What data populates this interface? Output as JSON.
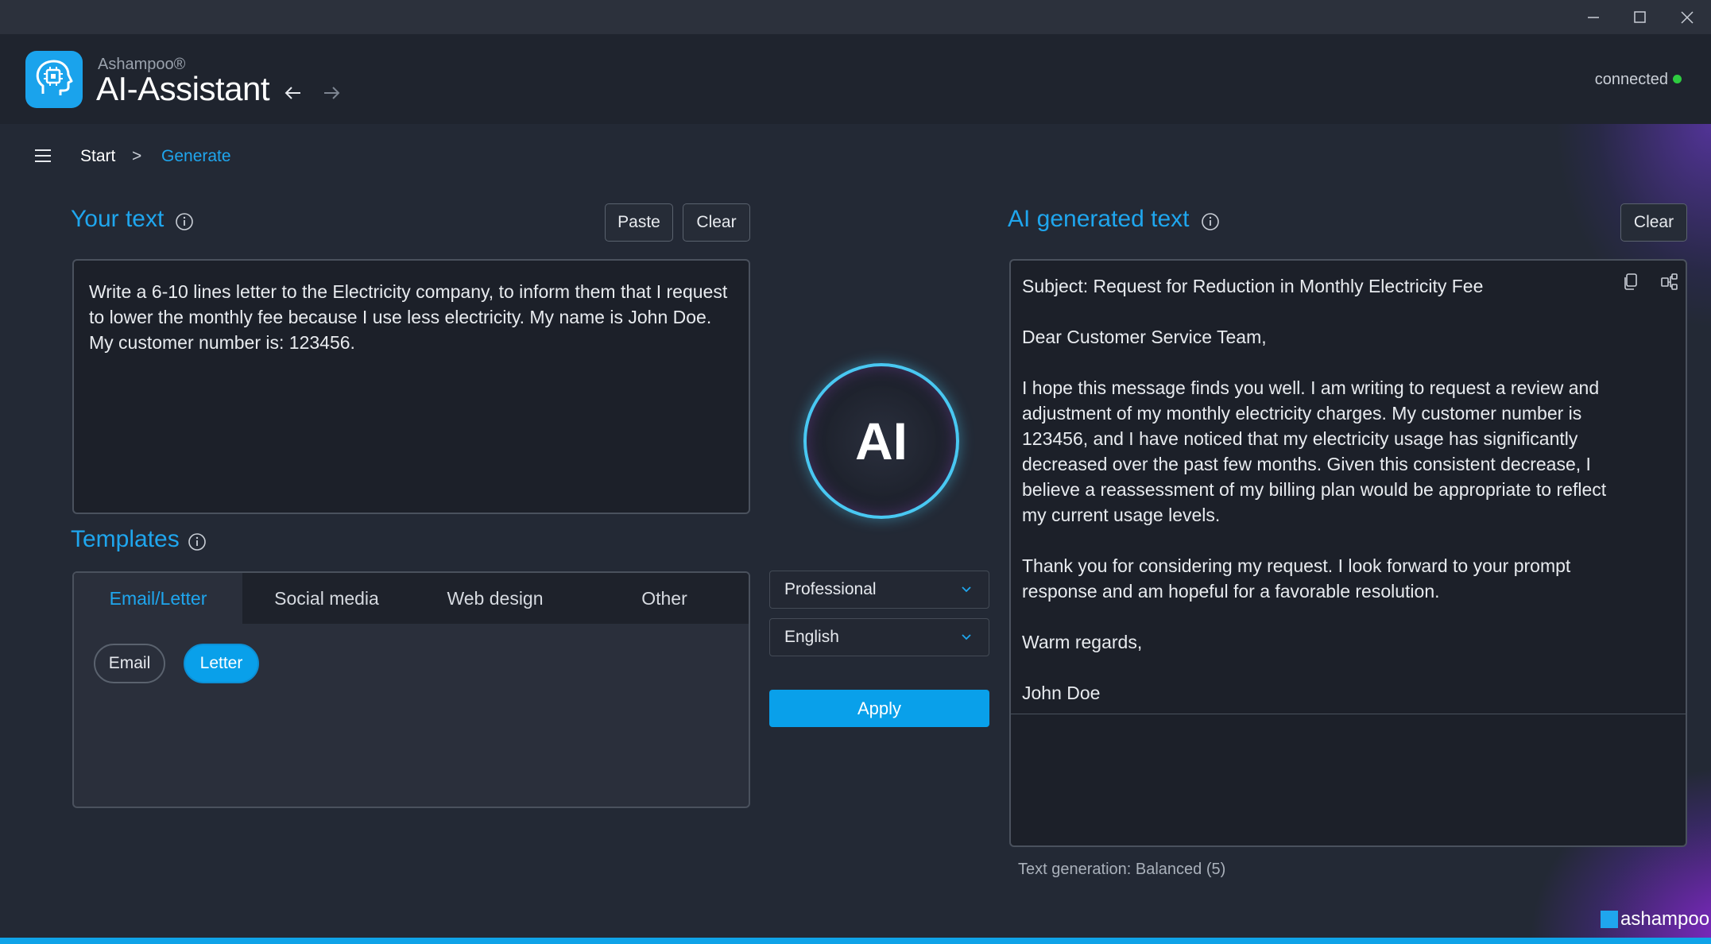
{
  "window": {
    "controls": [
      "minimize-icon",
      "maximize-icon",
      "close-icon"
    ]
  },
  "app": {
    "brand": "Ashampoo®",
    "title": "AI-Assistant"
  },
  "connection": {
    "status": "connected",
    "color": "#2ecc40"
  },
  "breadcrumb": {
    "start": "Start",
    "separator": ">",
    "current": "Generate"
  },
  "input_section": {
    "title": "Your text",
    "paste_label": "Paste",
    "clear_label": "Clear",
    "text": "Write a 6-10 lines letter to the Electricity company, to inform them that I request to lower the monthly fee because I use less electricity. My name is John Doe. My customer number is: 123456."
  },
  "templates": {
    "title": "Templates",
    "tabs": [
      {
        "label": "Email/Letter",
        "active": true
      },
      {
        "label": "Social media"
      },
      {
        "label": "Web design"
      },
      {
        "label": "Other"
      }
    ],
    "chips": [
      {
        "label": "Email",
        "selected": false
      },
      {
        "label": "Letter",
        "selected": true
      }
    ]
  },
  "center": {
    "ai_badge": "AI",
    "tone": {
      "value": "Professional"
    },
    "language": {
      "value": "English"
    },
    "apply_label": "Apply"
  },
  "output_section": {
    "title": "AI generated text",
    "clear_label": "Clear",
    "paragraphs": [
      "Subject: Request for Reduction in Monthly Electricity Fee",
      "Dear Customer Service Team,",
      "I hope this message finds you well. I am writing to request a review and adjustment of my monthly electricity charges. My customer number is 123456, and I have noticed that my electricity usage has significantly decreased over the past few months. Given this consistent decrease, I believe a reassessment of my billing plan would be appropriate to reflect my current usage levels.",
      "Thank you for considering my request. I look forward to your prompt response and am hopeful for a favorable resolution.",
      "Warm regards,",
      "John Doe"
    ],
    "status": "Text generation:  Balanced (5)"
  },
  "footer": {
    "logo_text": "ashampoo"
  },
  "colors": {
    "accent": "#1fa6ee",
    "apply": "#09a0ea",
    "background": "#232935"
  }
}
